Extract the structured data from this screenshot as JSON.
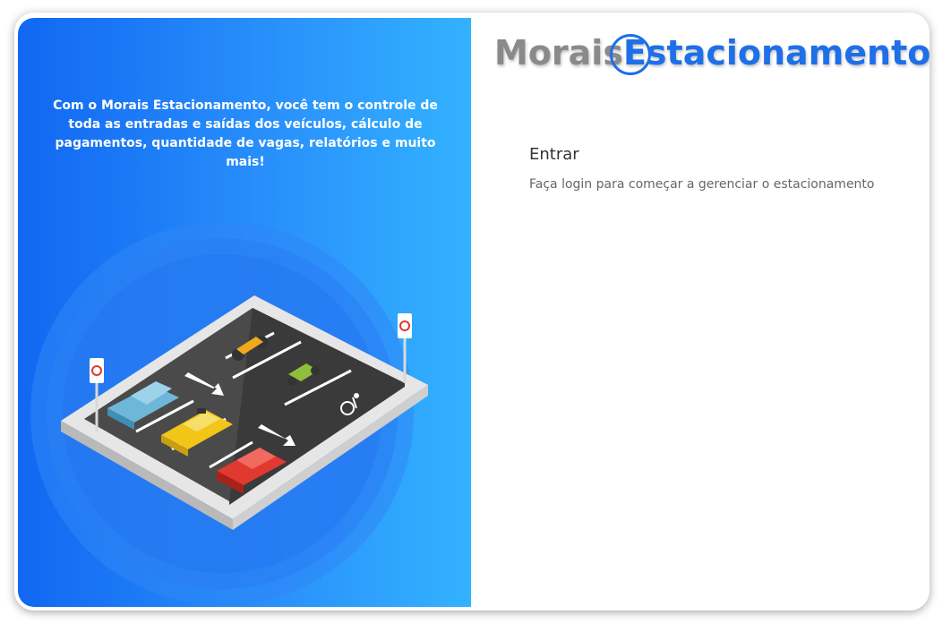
{
  "brand": {
    "logo_part1": "Morais",
    "logo_part2": "Estacionamento",
    "tagline": "Com o Morais Estacionamento, você tem o controle de toda as entradas e saídas dos veículos, cálculo de pagamentos, quantidade de vagas, relatórios e muito mais!"
  },
  "login": {
    "title": "Entrar",
    "subtitle": "Faça login para começar a gerenciar o estacionamento"
  },
  "colors": {
    "accent": "#1e6fe8",
    "panel_gradient_start": "#1167f2",
    "panel_gradient_end": "#33b2ff"
  }
}
